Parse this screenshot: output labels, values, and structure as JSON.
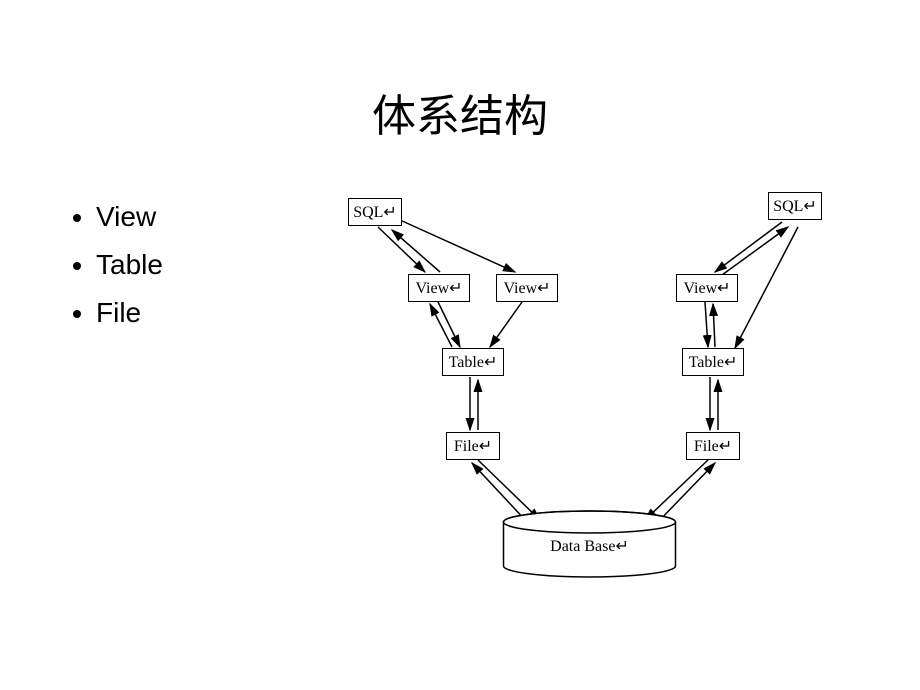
{
  "title": "体系结构",
  "bullets": [
    "View",
    "Table",
    "File"
  ],
  "nodes": {
    "sql1": "SQL↵",
    "sql2": "SQL↵",
    "view1": "View↵",
    "view2": "View↵",
    "view3": "View↵",
    "table1": "Table↵",
    "table2": "Table↵",
    "file1": "File↵",
    "file2": "File↵",
    "database": "Data Base↵"
  }
}
